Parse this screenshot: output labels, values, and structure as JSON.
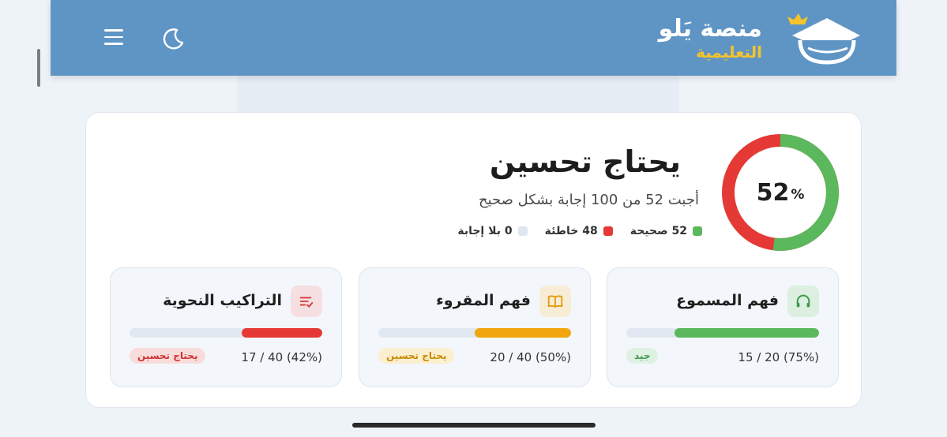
{
  "header": {
    "logo_line1": "منصة يَلو",
    "logo_line2": "التعليمية",
    "icons": [
      "menu-icon",
      "moon-icon",
      "graduation-cap-icon"
    ],
    "colors": {
      "header_bg": "#5f95c5",
      "logo_accent": "#f6c32a"
    }
  },
  "summary": {
    "percent": "52",
    "percent_sign": "%",
    "status": "يحتاج تحسين",
    "subtitle": "أجبت 52 من 100 إجابة بشكل صحيح",
    "correct_fraction": 0.52,
    "legend": [
      {
        "label": "52 صحيحة",
        "color": "#5cb85c"
      },
      {
        "label": "48 خاطئة",
        "color": "#e53935"
      },
      {
        "label": "0 بلا إجابة",
        "color": "#dfe7f0"
      }
    ]
  },
  "skills": [
    {
      "title": "فهم المسموع",
      "icon": "headphones-icon",
      "score": "15 / 20 (75%)",
      "progress": 0.75,
      "bar_color": "#5cb85c",
      "icon_bg": "#dcefe0",
      "icon_color": "#3d9a4d",
      "badge": "جيد",
      "badge_bg": "#dff1e2",
      "badge_color": "#3d9a4d"
    },
    {
      "title": "فهم المقروء",
      "icon": "book-icon",
      "score": "20 / 40 (50%)",
      "progress": 0.5,
      "bar_color": "#f2a60e",
      "icon_bg": "#f7ecd6",
      "icon_color": "#e39b0c",
      "badge": "يحتاج تحسين",
      "badge_bg": "#fbefcf",
      "badge_color": "#c98a00"
    },
    {
      "title": "التراكيب النحوية",
      "icon": "grammar-list-icon",
      "score": "17 / 40 (42%)",
      "progress": 0.42,
      "bar_color": "#e53935",
      "icon_bg": "#f6dfe1",
      "icon_color": "#d33b3b",
      "badge": "يحتاج تحسين",
      "badge_bg": "#f8dcdc",
      "badge_color": "#d13232"
    }
  ]
}
